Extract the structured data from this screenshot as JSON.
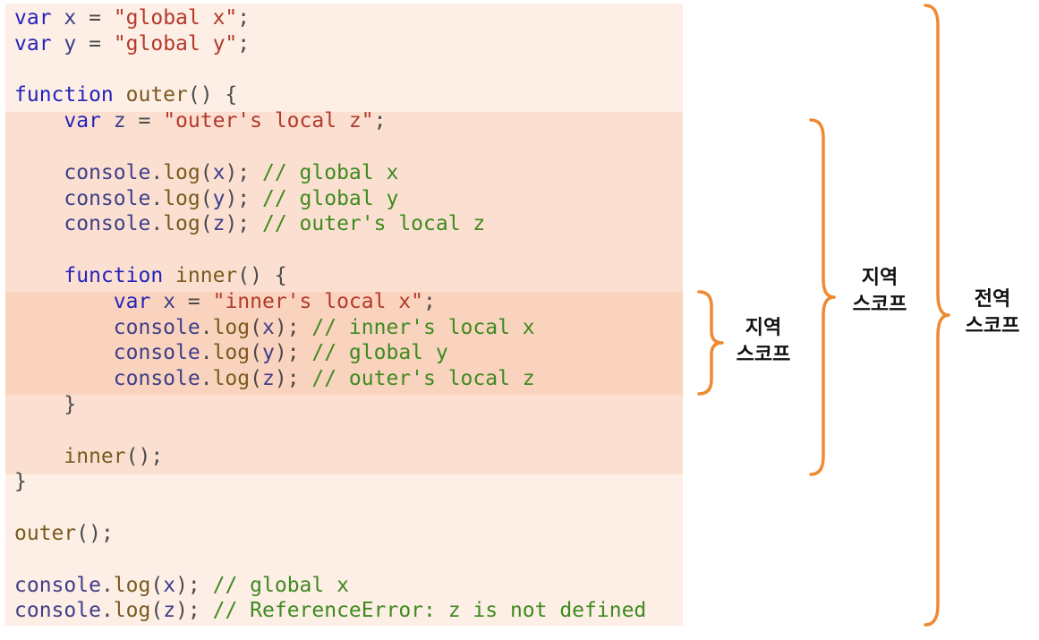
{
  "code": [
    [
      [
        "kw",
        "var"
      ],
      [
        "pun",
        " "
      ],
      [
        "id",
        "x"
      ],
      [
        "pun",
        " = "
      ],
      [
        "str",
        "\"global x\""
      ],
      [
        "pun",
        ";"
      ]
    ],
    [
      [
        "kw",
        "var"
      ],
      [
        "pun",
        " "
      ],
      [
        "id",
        "y"
      ],
      [
        "pun",
        " = "
      ],
      [
        "str",
        "\"global y\""
      ],
      [
        "pun",
        ";"
      ]
    ],
    [],
    [
      [
        "kw",
        "function"
      ],
      [
        "pun",
        " "
      ],
      [
        "fn",
        "outer"
      ],
      [
        "pun",
        "() {"
      ]
    ],
    [
      [
        "pun",
        "    "
      ],
      [
        "kw",
        "var"
      ],
      [
        "pun",
        " "
      ],
      [
        "id",
        "z"
      ],
      [
        "pun",
        " = "
      ],
      [
        "str",
        "\"outer's local z\""
      ],
      [
        "pun",
        ";"
      ]
    ],
    [],
    [
      [
        "pun",
        "    "
      ],
      [
        "id",
        "console"
      ],
      [
        "pun",
        "."
      ],
      [
        "fn",
        "log"
      ],
      [
        "pun",
        "("
      ],
      [
        "id",
        "x"
      ],
      [
        "pun",
        "); "
      ],
      [
        "cm",
        "// global x"
      ]
    ],
    [
      [
        "pun",
        "    "
      ],
      [
        "id",
        "console"
      ],
      [
        "pun",
        "."
      ],
      [
        "fn",
        "log"
      ],
      [
        "pun",
        "("
      ],
      [
        "id",
        "y"
      ],
      [
        "pun",
        "); "
      ],
      [
        "cm",
        "// global y"
      ]
    ],
    [
      [
        "pun",
        "    "
      ],
      [
        "id",
        "console"
      ],
      [
        "pun",
        "."
      ],
      [
        "fn",
        "log"
      ],
      [
        "pun",
        "("
      ],
      [
        "id",
        "z"
      ],
      [
        "pun",
        "); "
      ],
      [
        "cm",
        "// outer's local z"
      ]
    ],
    [],
    [
      [
        "pun",
        "    "
      ],
      [
        "kw",
        "function"
      ],
      [
        "pun",
        " "
      ],
      [
        "fn",
        "inner"
      ],
      [
        "pun",
        "() {"
      ]
    ],
    [
      [
        "pun",
        "        "
      ],
      [
        "kw",
        "var"
      ],
      [
        "pun",
        " "
      ],
      [
        "id",
        "x"
      ],
      [
        "pun",
        " = "
      ],
      [
        "str",
        "\"inner's local x\""
      ],
      [
        "pun",
        ";"
      ]
    ],
    [
      [
        "pun",
        "        "
      ],
      [
        "id",
        "console"
      ],
      [
        "pun",
        "."
      ],
      [
        "fn",
        "log"
      ],
      [
        "pun",
        "("
      ],
      [
        "id",
        "x"
      ],
      [
        "pun",
        "); "
      ],
      [
        "cm",
        "// inner's local x"
      ]
    ],
    [
      [
        "pun",
        "        "
      ],
      [
        "id",
        "console"
      ],
      [
        "pun",
        "."
      ],
      [
        "fn",
        "log"
      ],
      [
        "pun",
        "("
      ],
      [
        "id",
        "y"
      ],
      [
        "pun",
        "); "
      ],
      [
        "cm",
        "// global y"
      ]
    ],
    [
      [
        "pun",
        "        "
      ],
      [
        "id",
        "console"
      ],
      [
        "pun",
        "."
      ],
      [
        "fn",
        "log"
      ],
      [
        "pun",
        "("
      ],
      [
        "id",
        "z"
      ],
      [
        "pun",
        "); "
      ],
      [
        "cm",
        "// outer's local z"
      ]
    ],
    [
      [
        "pun",
        "    }"
      ]
    ],
    [],
    [
      [
        "pun",
        "    "
      ],
      [
        "fn",
        "inner"
      ],
      [
        "pun",
        "();"
      ]
    ],
    [
      [
        "pun",
        "}"
      ]
    ],
    [],
    [
      [
        "fn",
        "outer"
      ],
      [
        "pun",
        "();"
      ]
    ],
    [],
    [
      [
        "id",
        "console"
      ],
      [
        "pun",
        "."
      ],
      [
        "fn",
        "log"
      ],
      [
        "pun",
        "("
      ],
      [
        "id",
        "x"
      ],
      [
        "pun",
        "); "
      ],
      [
        "cm",
        "// global x"
      ]
    ],
    [
      [
        "id",
        "console"
      ],
      [
        "pun",
        "."
      ],
      [
        "fn",
        "log"
      ],
      [
        "pun",
        "("
      ],
      [
        "id",
        "z"
      ],
      [
        "pun",
        "); "
      ],
      [
        "cm",
        "// ReferenceError: z is not defined"
      ]
    ]
  ],
  "labels": {
    "inner_scope": [
      "지역",
      "스코프"
    ],
    "outer_scope": [
      "지역",
      "스코프"
    ],
    "global_scope": [
      "전역",
      "스코프"
    ]
  },
  "colors": {
    "bracket": "#ef8a30",
    "global_bg": "#fdeee6",
    "outer_bg": "#fbe0d2",
    "inner_bg": "#f9d3be"
  }
}
